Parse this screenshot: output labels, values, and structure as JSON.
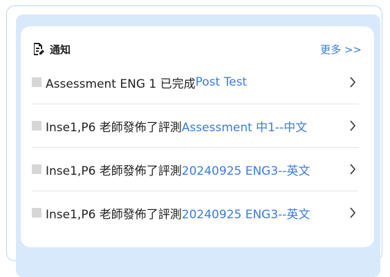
{
  "panel": {
    "title": "通知",
    "more_label": "更多 >>",
    "icon": "document-edit-icon"
  },
  "notifications": [
    {
      "text": "Assessment ENG 1 已完成",
      "link": " Post Test"
    },
    {
      "text": "Inse1,P6 老師發佈了評測",
      "link": " Assessment 中1--中文"
    },
    {
      "text": "Inse1,P6 老師發佈了評測",
      "link": " 20240925 ENG3--英文"
    },
    {
      "text": "Inse1,P6 老師發佈了評測",
      "link": " 20240925 ENG3--英文"
    }
  ],
  "colors": {
    "accent": "#3a7be0",
    "frame": "#d7e9fb",
    "bullet": "#d6d6d6"
  }
}
